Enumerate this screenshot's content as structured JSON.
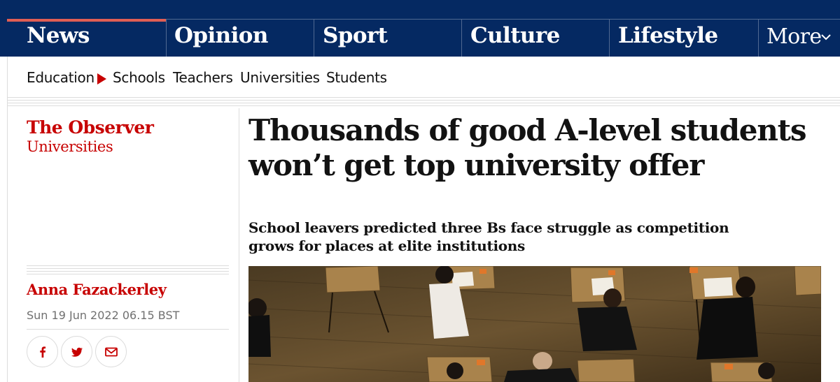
{
  "nav": {
    "pillars": [
      {
        "label": "News",
        "active": true
      },
      {
        "label": "Opinion",
        "active": false
      },
      {
        "label": "Sport",
        "active": false
      },
      {
        "label": "Culture",
        "active": false
      },
      {
        "label": "Lifestyle",
        "active": false
      }
    ],
    "more_label": "More"
  },
  "subnav": {
    "section": "Education",
    "items": [
      "Schools",
      "Teachers",
      "Universities",
      "Students"
    ]
  },
  "series": {
    "title": "The Observer",
    "subtitle": "Universities"
  },
  "article": {
    "headline": "Thousands of good A-level students won’t get top university offer",
    "standfirst": "School leavers predicted three Bs face struggle as competition grows for places at elite institutions",
    "author": "Anna Fazackerley",
    "date": "Sun 19 Jun 2022 06.15 BST"
  },
  "share": [
    {
      "icon": "facebook-icon"
    },
    {
      "icon": "twitter-icon"
    },
    {
      "icon": "email-icon"
    }
  ],
  "colors": {
    "brand_blue": "#052962",
    "news_red": "#c70000",
    "active_pillar": "#e05e54"
  }
}
